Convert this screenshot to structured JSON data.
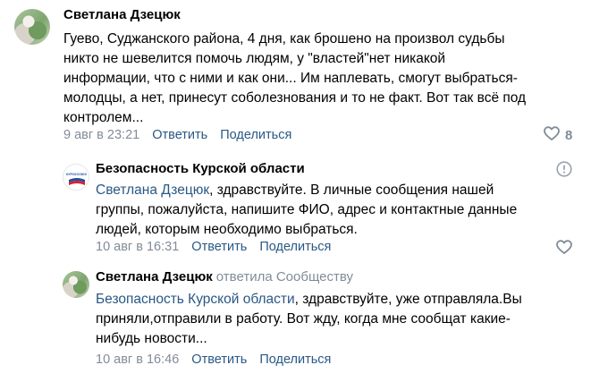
{
  "comments": [
    {
      "author": "Светлана Дзецюк",
      "lines": [
        "Гуево, Суджанского района, 4 дня, как брошено на произвол судьбы",
        "никто не шевелится помочь людям, у \"властей\"нет никакой",
        "информации, что с ними и как они... Им наплевать, смогут выбраться-",
        "молодцы, а нет, принесут соболезнования и то не факт. Вот так всё под",
        "контролем..."
      ],
      "time": "9 авг в 23:21",
      "reply_label": "Ответить",
      "share_label": "Поделиться",
      "likes": "8"
    },
    {
      "author": "Безопасность Курской области",
      "mention": "Светлана Дзецюк",
      "lines": [
        ", здравствуйте. В личные сообщения нашей",
        "группы, пожалуйста, напишите ФИО, адрес и контактные данные",
        "людей, которым необходимо выбраться."
      ],
      "time": "10 авг в 16:31",
      "reply_label": "Ответить",
      "share_label": "Поделиться",
      "avatar_text": "КУРСКСОЮЗ"
    },
    {
      "author": "Светлана Дзецюк",
      "reply_tag": "ответила Сообществу",
      "mention": "Безопасность Курской области",
      "lines": [
        ", здравствуйте, уже отправляла.Вы",
        "приняли,отправили в работу. Вот жду, когда мне сообщат какие-",
        "нибудь новости..."
      ],
      "time": "10 авг в 16:46",
      "reply_label": "Ответить",
      "share_label": "Поделиться"
    }
  ],
  "colors": {
    "link": "#2a5885",
    "meta": "#818c99",
    "text": "#000000"
  }
}
